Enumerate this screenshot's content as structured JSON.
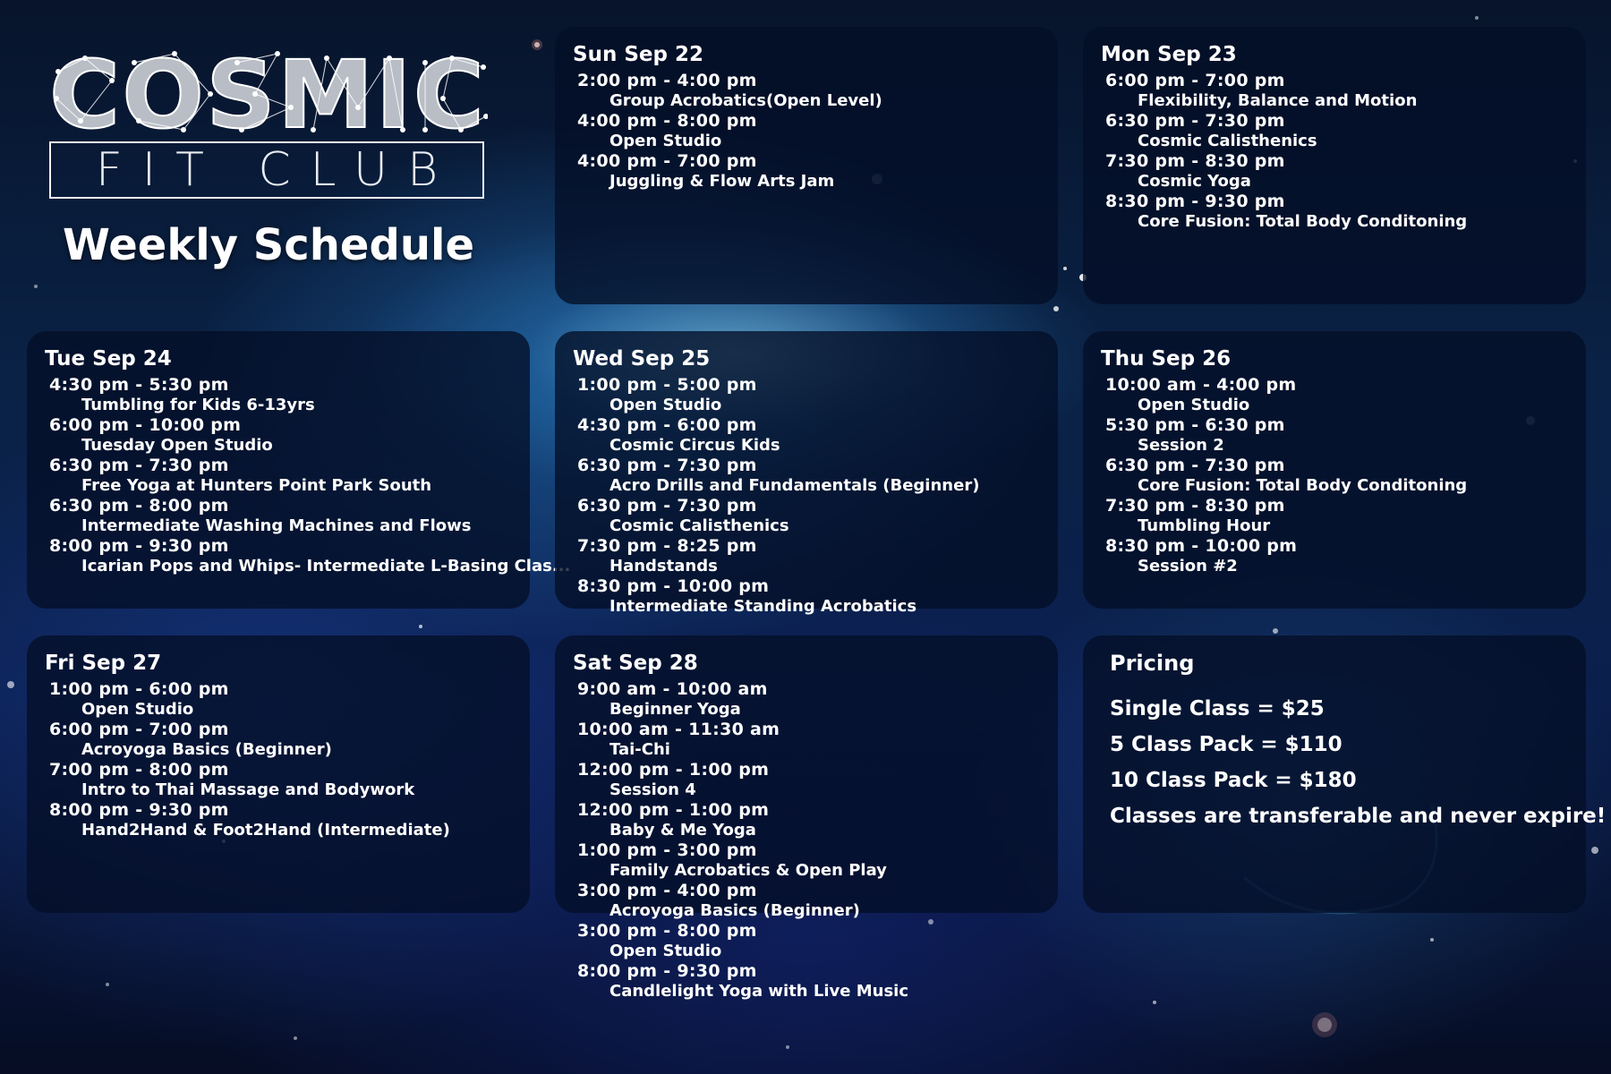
{
  "logo": {
    "word": "COSMIC",
    "sub": "FIT CLUB"
  },
  "headline": "Weekly Schedule",
  "days": [
    {
      "title": "Sun Sep 22",
      "sessions": [
        {
          "time": "2:00 pm -  4:00 pm",
          "name": "Group Acrobatics(Open Level)"
        },
        {
          "time": "4:00 pm -  8:00 pm",
          "name": "Open Studio"
        },
        {
          "time": "4:00 pm -  7:00 pm",
          "name": "Juggling & Flow Arts Jam"
        }
      ]
    },
    {
      "title": "Mon Sep 23",
      "sessions": [
        {
          "time": "6:00 pm -  7:00 pm",
          "name": "Flexibility, Balance and Motion"
        },
        {
          "time": "6:30 pm -  7:30 pm",
          "name": "Cosmic Calisthenics"
        },
        {
          "time": "7:30 pm -  8:30 pm",
          "name": "Cosmic Yoga"
        },
        {
          "time": "8:30 pm -  9:30 pm",
          "name": "Core Fusion: Total Body Conditoning"
        }
      ]
    },
    {
      "title": "Tue Sep 24",
      "sessions": [
        {
          "time": "4:30 pm -  5:30 pm",
          "name": "Tumbling for Kids 6-13yrs"
        },
        {
          "time": "6:00 pm - 10:00 pm",
          "name": "Tuesday Open Studio"
        },
        {
          "time": "6:30 pm -  7:30 pm",
          "name": "Free Yoga at Hunters Point Park South"
        },
        {
          "time": "6:30 pm -  8:00 pm",
          "name": "Intermediate Washing Machines and Flows"
        },
        {
          "time": "8:00 pm -  9:30 pm",
          "name": "Icarian Pops and Whips- Intermediate L-Basing Clas..."
        }
      ]
    },
    {
      "title": "Wed Sep 25",
      "sessions": [
        {
          "time": "1:00 pm -  5:00 pm",
          "name": "Open Studio"
        },
        {
          "time": "4:30 pm -  6:00 pm",
          "name": "Cosmic Circus Kids"
        },
        {
          "time": "6:30 pm -  7:30 pm",
          "name": "Acro Drills and Fundamentals (Beginner)"
        },
        {
          "time": "6:30 pm -  7:30 pm",
          "name": "Cosmic Calisthenics"
        },
        {
          "time": "7:30 pm -  8:25 pm",
          "name": "Handstands"
        },
        {
          "time": "8:30 pm - 10:00 pm",
          "name": "Intermediate Standing Acrobatics"
        }
      ]
    },
    {
      "title": "Thu Sep 26",
      "sessions": [
        {
          "time": "10:00 am -  4:00 pm",
          "name": "Open Studio"
        },
        {
          "time": "5:30 pm -  6:30 pm",
          "name": "Session 2"
        },
        {
          "time": "6:30 pm -  7:30 pm",
          "name": "Core Fusion: Total Body Conditoning"
        },
        {
          "time": "7:30 pm -  8:30 pm",
          "name": "Tumbling Hour"
        },
        {
          "time": "8:30 pm - 10:00 pm",
          "name": "Session #2"
        }
      ]
    },
    {
      "title": "Fri Sep 27",
      "sessions": [
        {
          "time": "1:00 pm -  6:00 pm",
          "name": "Open Studio"
        },
        {
          "time": "6:00 pm -  7:00 pm",
          "name": "Acroyoga Basics (Beginner)"
        },
        {
          "time": "7:00 pm -  8:00 pm",
          "name": "Intro to Thai Massage and Bodywork"
        },
        {
          "time": "8:00 pm -  9:30 pm",
          "name": "Hand2Hand & Foot2Hand (Intermediate)"
        }
      ]
    },
    {
      "title": "Sat Sep 28",
      "sessions": [
        {
          "time": "9:00 am - 10:00 am",
          "name": "Beginner Yoga"
        },
        {
          "time": "10:00 am - 11:30 am",
          "name": "Tai-Chi"
        },
        {
          "time": "12:00 pm -  1:00 pm",
          "name": "Session 4"
        },
        {
          "time": "12:00 pm -  1:00 pm",
          "name": "Baby & Me Yoga"
        },
        {
          "time": "1:00 pm -  3:00 pm",
          "name": "Family Acrobatics & Open Play"
        },
        {
          "time": "3:00 pm -  4:00 pm",
          "name": "Acroyoga Basics (Beginner)"
        },
        {
          "time": "3:00 pm -  8:00 pm",
          "name": "Open Studio"
        },
        {
          "time": "8:00 pm -  9:30 pm",
          "name": "Candlelight Yoga with Live Music"
        }
      ]
    }
  ],
  "pricing": {
    "title": "Pricing",
    "lines": [
      "Single Class = $25",
      "5 Class Pack = $110",
      "10 Class Pack = $180",
      "Classes are transferable and never expire!"
    ]
  },
  "colors": {
    "panel": "#040e26",
    "text": "#ffffff",
    "glow": "#9fe3ff"
  }
}
